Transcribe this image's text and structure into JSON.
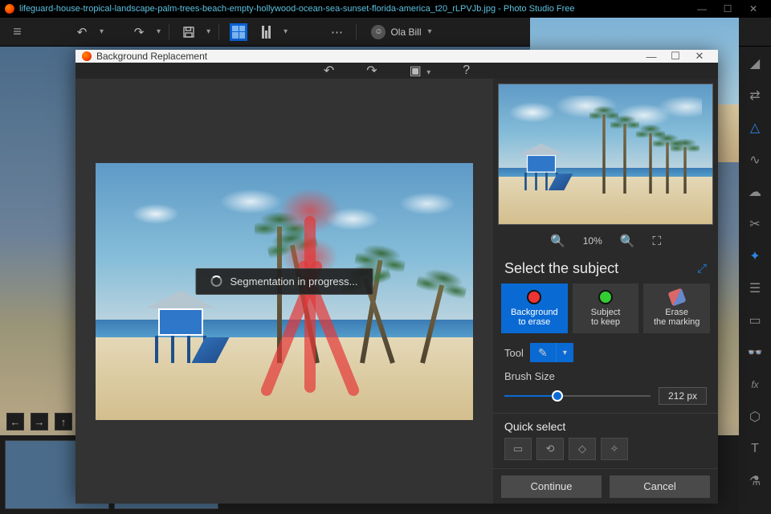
{
  "window": {
    "filename": "lifeguard-house-tropical-landscape-palm-trees-beach-empty-hollywood-ocean-sea-sunset-florida-america_t20_rLPVJb.jpg",
    "app_name": "Photo Studio Free"
  },
  "user": {
    "name": "Ola Bill"
  },
  "dialog": {
    "title": "Background Replacement",
    "progress_text": "Segmentation in progress...",
    "zoom_pct": "10%",
    "section_title": "Select the subject",
    "modes": {
      "bg": {
        "line1": "Background",
        "line2": "to erase"
      },
      "subj": {
        "line1": "Subject",
        "line2": "to keep"
      },
      "erase": {
        "line1": "Erase",
        "line2": "the marking"
      }
    },
    "tool_label": "Tool",
    "brush_label": "Brush Size",
    "brush_value": "212 px",
    "quick_label": "Quick select",
    "continue_label": "Continue",
    "cancel_label": "Cancel"
  },
  "colors": {
    "accent": "#0a6ad4",
    "mask": "rgba(228,56,56,.7)"
  }
}
